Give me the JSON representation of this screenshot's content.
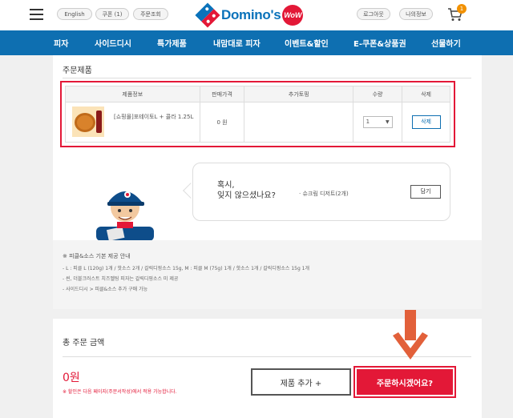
{
  "header": {
    "lang_label": "English",
    "coupon_label": "쿠폰 (1)",
    "order_lookup_label": "주문조회",
    "logo_text": "Domino's",
    "logo_badge": "WoW",
    "logout_label": "로그아웃",
    "myinfo_label": "나의정보",
    "cart_count": "1"
  },
  "nav": {
    "items": [
      "피자",
      "사이드디시",
      "특가제품",
      "내맘대로 피자",
      "이벤트&할인",
      "E-쿠폰&상품권",
      "선물하기"
    ]
  },
  "order": {
    "section_title": "주문제품",
    "columns": [
      "제품정보",
      "판매가격",
      "추가토핑",
      "수량",
      "삭제"
    ],
    "row": {
      "product_name": "[쇼핑몰]포테이토L + 콜라 1.25L",
      "price": "0 원",
      "topping": "",
      "qty": "1",
      "delete_label": "삭제"
    }
  },
  "suggest": {
    "question_line1": "혹시,",
    "question_line2": "잊지 않으셨나요?",
    "item": "· 슈크림 디저트(2개)",
    "button_label": "담기"
  },
  "notice": {
    "title": "※ 피클&소스 기본 제공 안내",
    "lines": [
      "- L : 피클 L (120g) 1개 / 핫소스 2개 / 갈릭디핑소스 15g, M : 피클 M (75g) 1개 / 핫소스 1개 / 갈릭디핑소스 15g 1개",
      "- 씬, 더블크러스트 치즈멜팅 피자는 갈릭디핑소스 미 제공",
      "- 사이드디시 > 피클&소스 추가 구매 가능"
    ]
  },
  "total": {
    "title": "총 주문 금액",
    "amount": "0원",
    "note": "※ 할인은 다음 페이지(주문서작성)에서 적용 가능합니다.",
    "add_label": "제품 추가 +",
    "order_label": "주문하시겠어요?"
  },
  "colors": {
    "brand_blue": "#0e6fb1",
    "brand_red": "#e31837",
    "arrow_orange": "#e2603a"
  }
}
